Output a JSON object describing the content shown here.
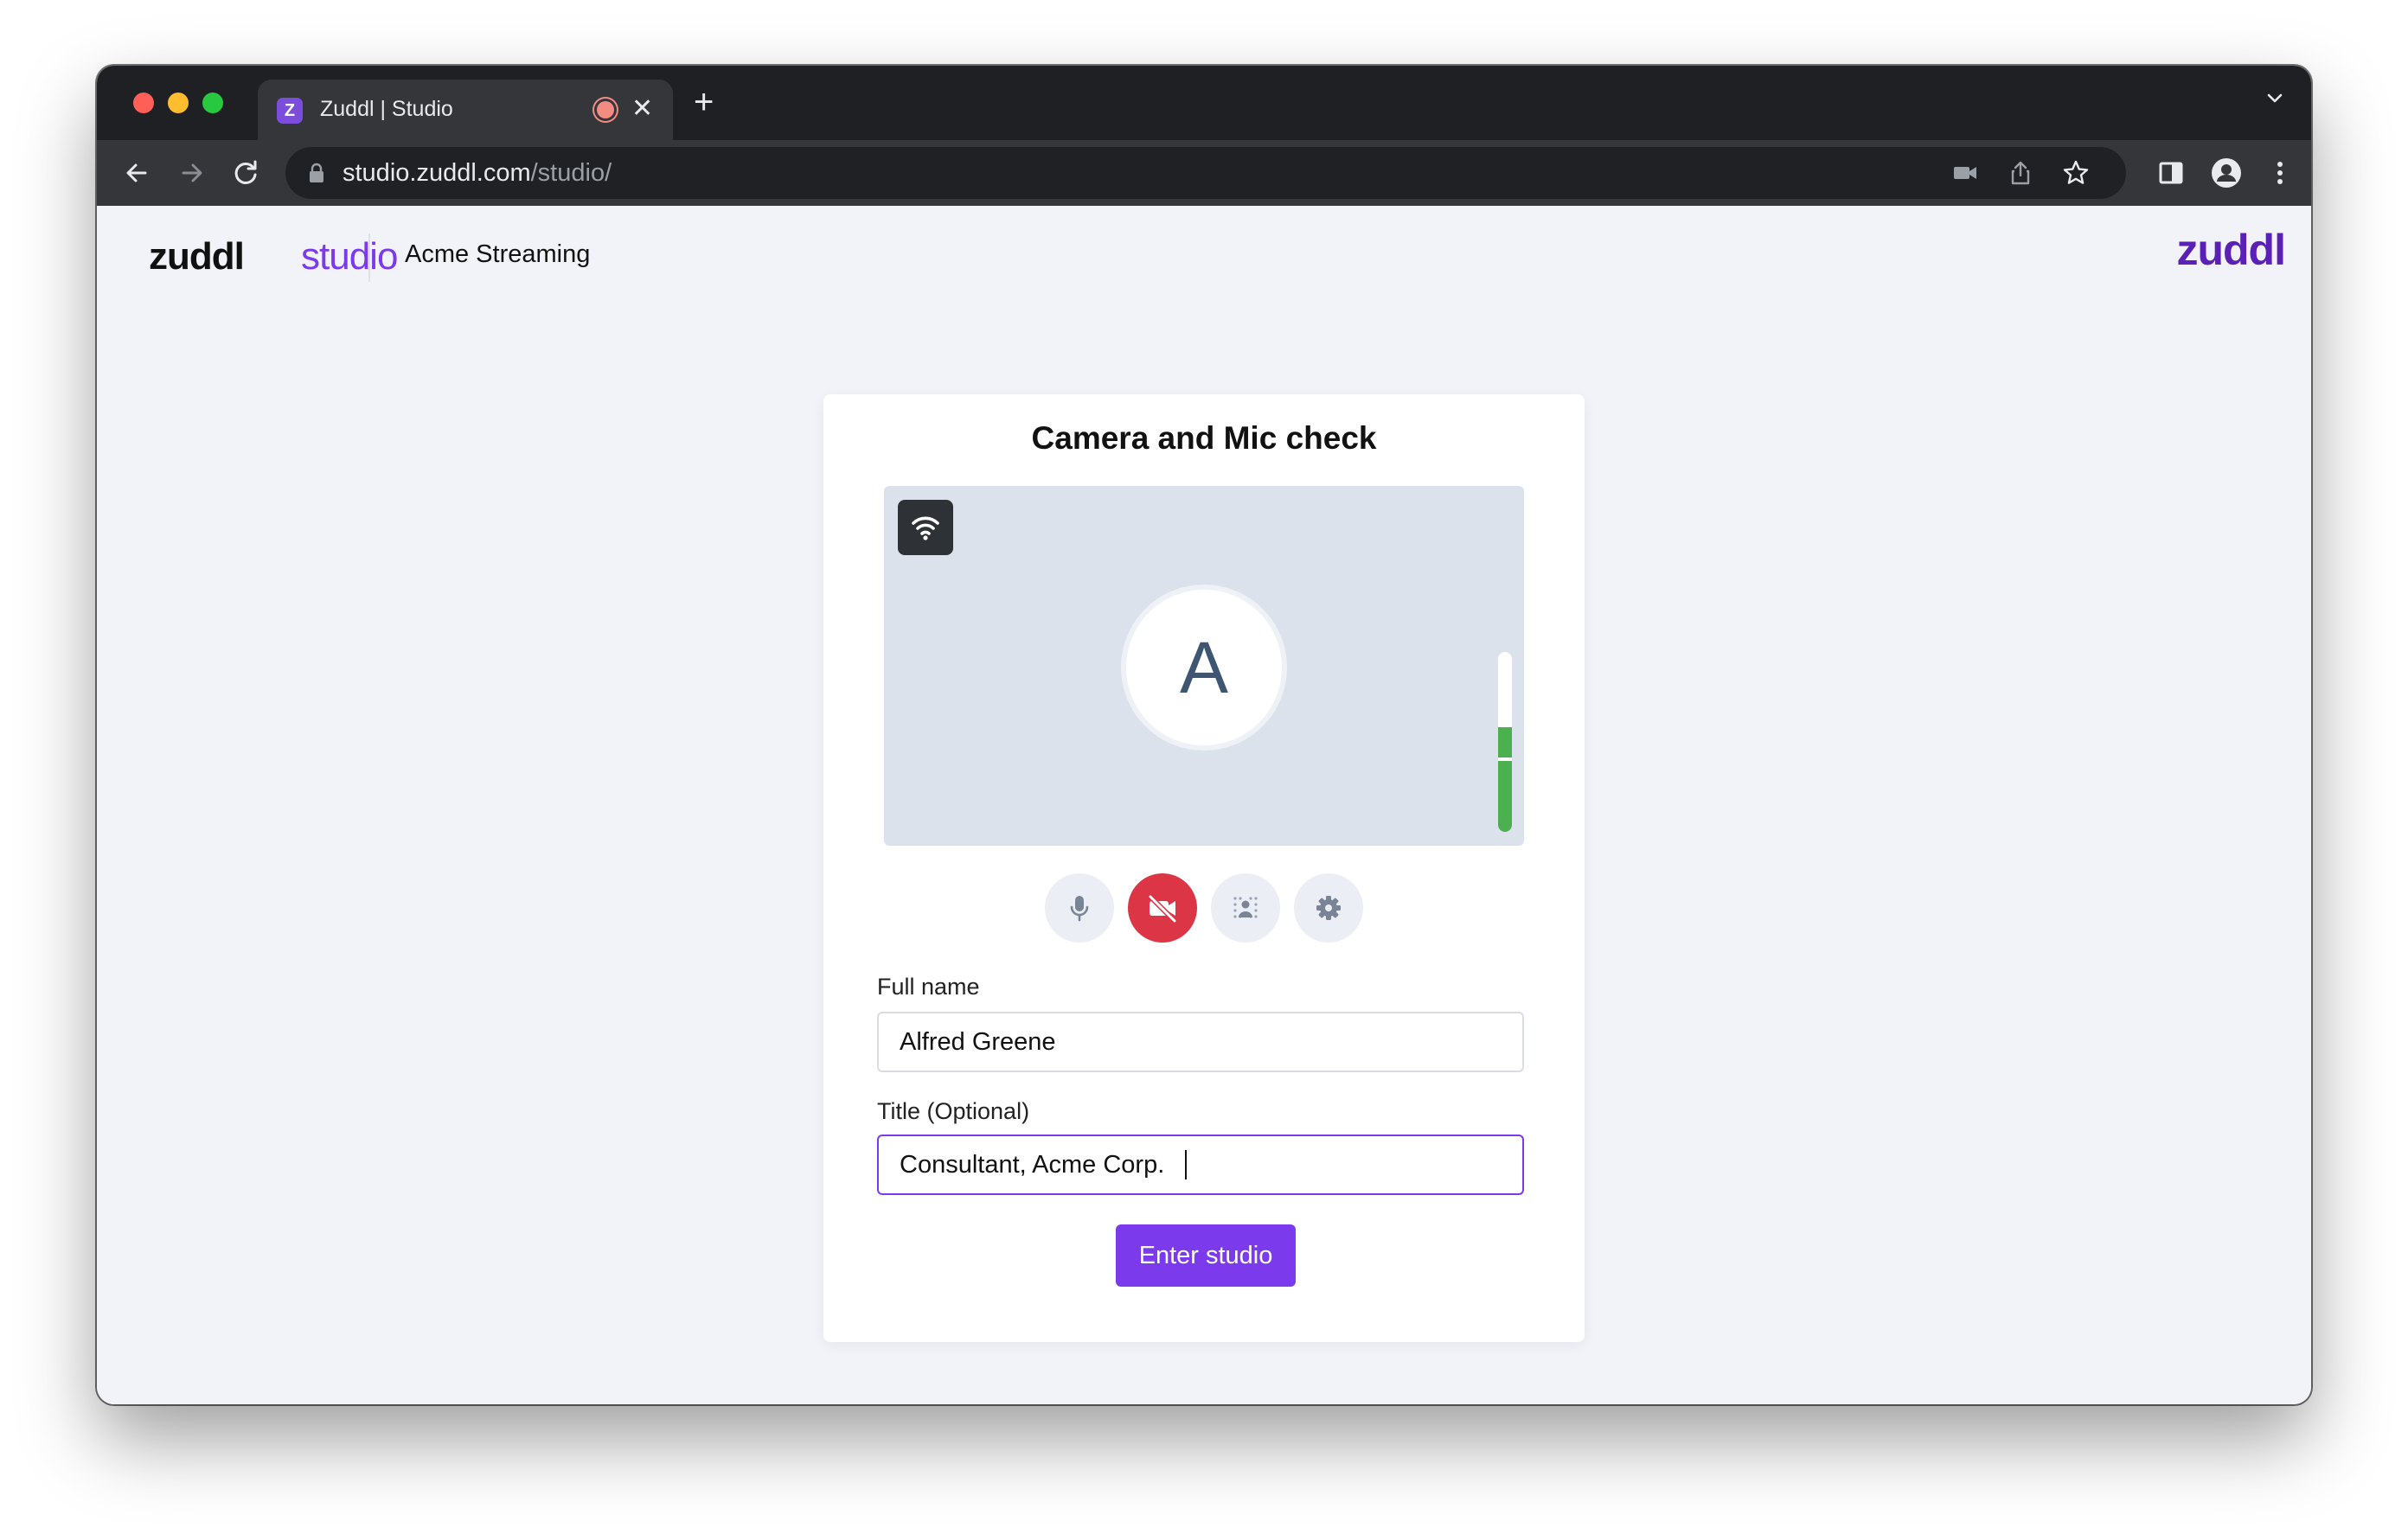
{
  "browser": {
    "tab": {
      "favicon_letter": "Z",
      "title": "Zuddl | Studio",
      "close_glyph": "✕"
    },
    "new_tab_glyph": "+",
    "url": {
      "host": "studio.zuddl.com",
      "path": "/studio/"
    }
  },
  "header": {
    "logo_word": "zuddl",
    "logo_suffix": "studio",
    "event_name": "Acme Streaming",
    "brand_right": "zuddl"
  },
  "card": {
    "title": "Camera and Mic check",
    "avatar_letter": "A",
    "audio_level": 0.58,
    "controls": [
      {
        "name": "microphone",
        "icon": "mic-icon",
        "state": "on"
      },
      {
        "name": "camera",
        "icon": "video-off-icon",
        "state": "off"
      },
      {
        "name": "background-effects",
        "icon": "background-blur-icon"
      },
      {
        "name": "settings",
        "icon": "gear-icon"
      }
    ],
    "full_name": {
      "label": "Full name",
      "value": "Alfred Greene"
    },
    "title_field": {
      "label": "Title (Optional)",
      "value": "Consultant, Acme Corp."
    },
    "submit_label": "Enter studio"
  },
  "colors": {
    "accent": "#7c3aed",
    "danger": "#dc3545",
    "audio": "#4caf50",
    "brand_dark": "#5b21b6"
  }
}
